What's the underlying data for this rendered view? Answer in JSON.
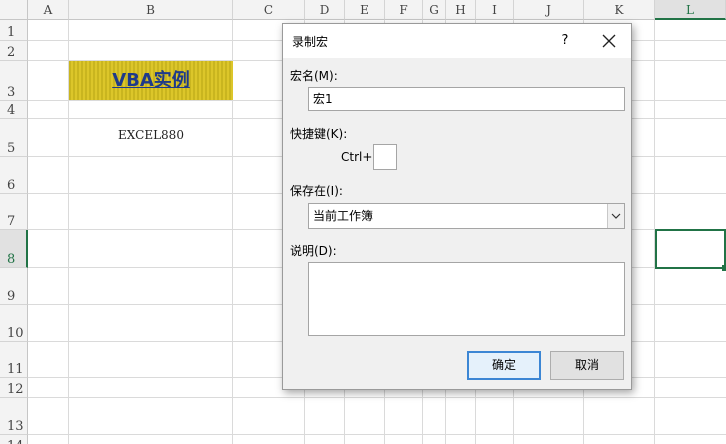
{
  "sheet": {
    "columns": [
      "A",
      "B",
      "C",
      "D",
      "E",
      "F",
      "G",
      "H",
      "I",
      "J",
      "K",
      "L"
    ],
    "selected_column": "L",
    "rows": [
      "1",
      "2",
      "3",
      "4",
      "5",
      "6",
      "7",
      "8",
      "9",
      "10",
      "11",
      "12",
      "13",
      "14"
    ],
    "selected_row": "8",
    "cells": {
      "b3": "VBA实例",
      "b5": "EXCEL880"
    },
    "colors": {
      "header_fill": "#c9b51f",
      "header_text": "#1e3a8a",
      "selection": "#217346"
    }
  },
  "dialog": {
    "title": "录制宏",
    "help_label": "?",
    "macro_name_label": "宏名(M):",
    "macro_name_value": "宏1",
    "shortcut_label": "快捷键(K):",
    "ctrl_label": "Ctrl+",
    "shortcut_value": "",
    "store_in_label": "保存在(I):",
    "store_in_value": "当前工作簿",
    "description_label": "说明(D):",
    "description_value": "",
    "ok_label": "确定",
    "cancel_label": "取消"
  }
}
